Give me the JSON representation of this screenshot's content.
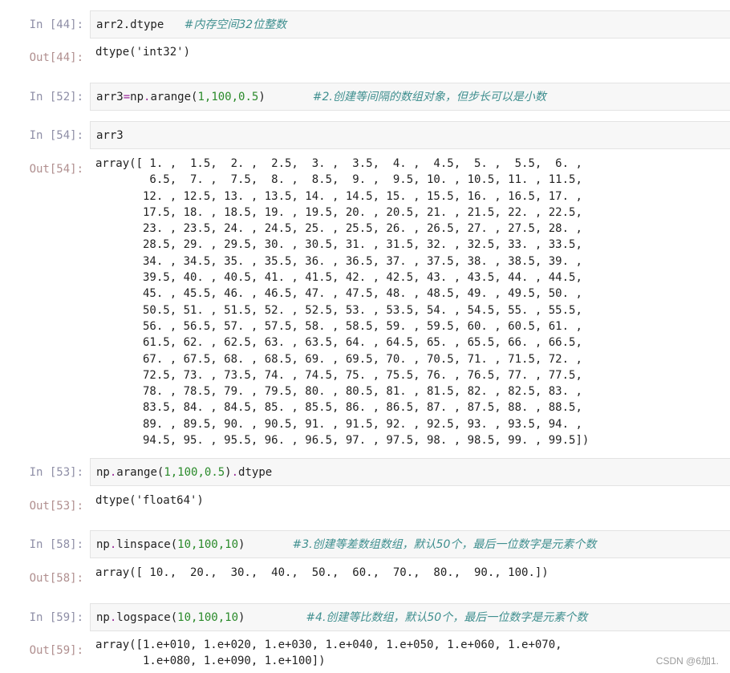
{
  "cells": {
    "c44": {
      "in_prompt": "In [44]:",
      "code": "arr2.dtype",
      "comment": "#内存空间32位整数",
      "out_prompt": "Out[44]:",
      "output": "dtype('int32')"
    },
    "c52": {
      "in_prompt": "In [52]:",
      "code_var": "arr3",
      "code_op": "=",
      "code_mod": "np",
      "code_dot": ".",
      "code_func": "arange(",
      "code_args": "1,100,0.5",
      "code_close": ")",
      "comment": "#2.创建等间隔的数组对象，但步长可以是小数"
    },
    "c54": {
      "in_prompt": "In [54]:",
      "code": "arr3",
      "out_prompt": "Out[54]:",
      "output_lines": [
        "array([ 1. ,  1.5,  2. ,  2.5,  3. ,  3.5,  4. ,  4.5,  5. ,  5.5,  6. ,",
        "        6.5,  7. ,  7.5,  8. ,  8.5,  9. ,  9.5, 10. , 10.5, 11. , 11.5,",
        "       12. , 12.5, 13. , 13.5, 14. , 14.5, 15. , 15.5, 16. , 16.5, 17. ,",
        "       17.5, 18. , 18.5, 19. , 19.5, 20. , 20.5, 21. , 21.5, 22. , 22.5,",
        "       23. , 23.5, 24. , 24.5, 25. , 25.5, 26. , 26.5, 27. , 27.5, 28. ,",
        "       28.5, 29. , 29.5, 30. , 30.5, 31. , 31.5, 32. , 32.5, 33. , 33.5,",
        "       34. , 34.5, 35. , 35.5, 36. , 36.5, 37. , 37.5, 38. , 38.5, 39. ,",
        "       39.5, 40. , 40.5, 41. , 41.5, 42. , 42.5, 43. , 43.5, 44. , 44.5,",
        "       45. , 45.5, 46. , 46.5, 47. , 47.5, 48. , 48.5, 49. , 49.5, 50. ,",
        "       50.5, 51. , 51.5, 52. , 52.5, 53. , 53.5, 54. , 54.5, 55. , 55.5,",
        "       56. , 56.5, 57. , 57.5, 58. , 58.5, 59. , 59.5, 60. , 60.5, 61. ,",
        "       61.5, 62. , 62.5, 63. , 63.5, 64. , 64.5, 65. , 65.5, 66. , 66.5,",
        "       67. , 67.5, 68. , 68.5, 69. , 69.5, 70. , 70.5, 71. , 71.5, 72. ,",
        "       72.5, 73. , 73.5, 74. , 74.5, 75. , 75.5, 76. , 76.5, 77. , 77.5,",
        "       78. , 78.5, 79. , 79.5, 80. , 80.5, 81. , 81.5, 82. , 82.5, 83. ,",
        "       83.5, 84. , 84.5, 85. , 85.5, 86. , 86.5, 87. , 87.5, 88. , 88.5,",
        "       89. , 89.5, 90. , 90.5, 91. , 91.5, 92. , 92.5, 93. , 93.5, 94. ,",
        "       94.5, 95. , 95.5, 96. , 96.5, 97. , 97.5, 98. , 98.5, 99. , 99.5])"
      ]
    },
    "c53": {
      "in_prompt": "In [53]:",
      "code_mod": "np",
      "code_dot": ".",
      "code_func": "arange(",
      "code_args": "1,100,0.5",
      "code_close": ")",
      "code_dot2": ".",
      "code_attr": "dtype",
      "out_prompt": "Out[53]:",
      "output": "dtype('float64')"
    },
    "c58": {
      "in_prompt": "In [58]:",
      "code_mod": "np",
      "code_dot": ".",
      "code_func": "linspace(",
      "code_args": "10,100,10",
      "code_close": ")",
      "comment": "#3.创建等差数组数组，默认50个，最后一位数字是元素个数",
      "out_prompt": "Out[58]:",
      "output": "array([ 10.,  20.,  30.,  40.,  50.,  60.,  70.,  80.,  90., 100.])"
    },
    "c59": {
      "in_prompt": "In [59]:",
      "code_mod": "np",
      "code_dot": ".",
      "code_func": "logspace(",
      "code_args": "10,100,10",
      "code_close": ")",
      "comment": "#4.创建等比数组，默认50个，最后一位数字是元素个数",
      "out_prompt": "Out[59]:",
      "output_lines": [
        "array([1.e+010, 1.e+020, 1.e+030, 1.e+040, 1.e+050, 1.e+060, 1.e+070,",
        "       1.e+080, 1.e+090, 1.e+100])"
      ]
    }
  },
  "watermark": "CSDN @6加1."
}
